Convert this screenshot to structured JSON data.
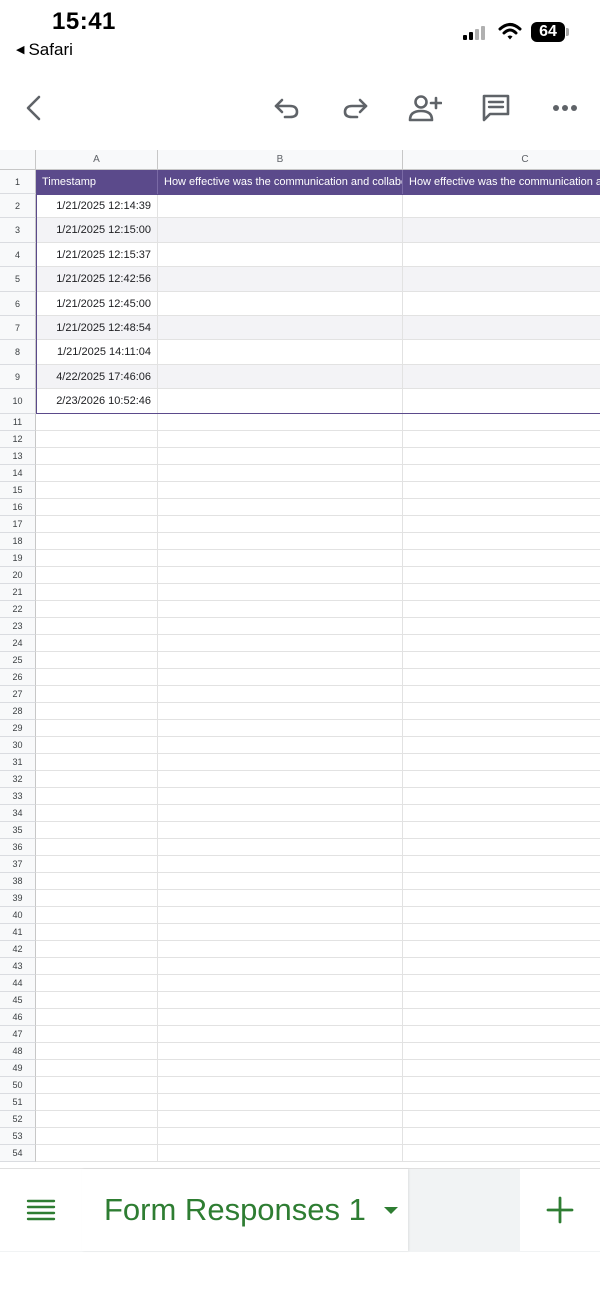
{
  "status_bar": {
    "time": "15:41",
    "back_app": "Safari",
    "battery": "64"
  },
  "toolbar": {
    "icons": [
      "back-icon",
      "undo-icon",
      "redo-icon",
      "share-add-person-icon",
      "comment-icon",
      "more-icon"
    ]
  },
  "sheet": {
    "columns": [
      "A",
      "B",
      "C"
    ],
    "header": [
      "Timestamp",
      "How effective was the communication and collabo",
      "How effective was the communication an"
    ],
    "rows": [
      {
        "num": "1"
      },
      {
        "num": "2",
        "timestamp": "1/21/2025 12:14:39"
      },
      {
        "num": "3",
        "timestamp": "1/21/2025 12:15:00"
      },
      {
        "num": "4",
        "timestamp": "1/21/2025 12:15:37"
      },
      {
        "num": "5",
        "timestamp": "1/21/2025 12:42:56"
      },
      {
        "num": "6",
        "timestamp": "1/21/2025 12:45:00"
      },
      {
        "num": "7",
        "timestamp": "1/21/2025 12:48:54"
      },
      {
        "num": "8",
        "timestamp": "1/21/2025 14:11:04"
      },
      {
        "num": "9",
        "timestamp": "4/22/2025 17:46:06"
      },
      {
        "num": "10",
        "timestamp": "2/23/2026 10:52:46"
      }
    ],
    "empty_row_numbers": [
      "11",
      "12",
      "13",
      "14",
      "15",
      "16",
      "17",
      "18",
      "19",
      "20",
      "21",
      "22",
      "23",
      "24",
      "25",
      "26",
      "27",
      "28",
      "29",
      "30",
      "31",
      "32",
      "33",
      "34",
      "35",
      "36",
      "37",
      "38",
      "39",
      "40",
      "41",
      "42",
      "43",
      "44",
      "45",
      "46",
      "47",
      "48",
      "49",
      "50",
      "51",
      "52",
      "53",
      "54"
    ],
    "header_color": "#5b4a8b"
  },
  "tabs": {
    "active_label": "Form Responses 1",
    "accent_color": "#2e7d32"
  }
}
